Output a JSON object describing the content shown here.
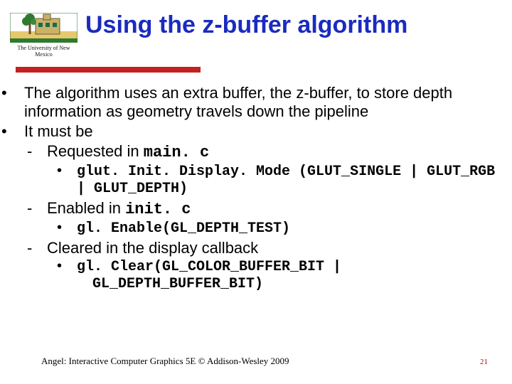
{
  "logo": {
    "caption": "The University of New Mexico"
  },
  "title": "Using the z-buffer algorithm",
  "bullets": {
    "b1a": "The algorithm uses an extra buffer, the z-buffer, to store depth information as geometry travels down the pipeline",
    "b1b": "It must be",
    "b2a_prefix": "Requested in ",
    "b2a_code": "main. c",
    "b3a_code": "glut. Init. Display. Mode (GLUT_SINGLE | GLUT_RGB | GLUT_DEPTH)",
    "b2b_prefix": "Enabled in ",
    "b2b_code": "init. c",
    "b3b_code": "gl. Enable(GL_DEPTH_TEST)",
    "b2c": "Cleared in the display callback",
    "b3c_code_l1": "gl. Clear(GL_COLOR_BUFFER_BIT |",
    "b3c_code_l2": "GL_DEPTH_BUFFER_BIT)"
  },
  "footer": {
    "citation": "Angel: Interactive Computer Graphics 5E © Addison-Wesley 2009",
    "page": "21"
  }
}
